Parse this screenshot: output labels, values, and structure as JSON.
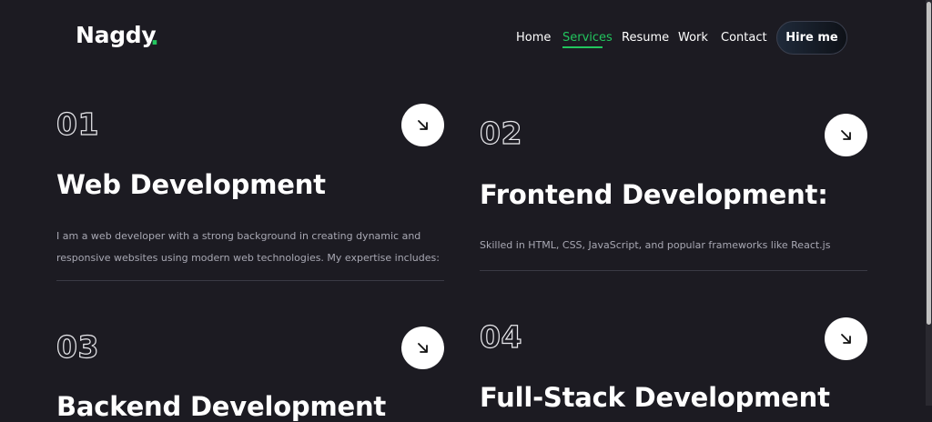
{
  "header": {
    "logo": "Nagdy",
    "logo_dot": ".",
    "nav": [
      {
        "label": "Home"
      },
      {
        "label": "Services"
      },
      {
        "label": "Resume"
      },
      {
        "label": "Work"
      },
      {
        "label": "Contact"
      }
    ],
    "hire_label": "Hire me"
  },
  "services": [
    {
      "num": "01",
      "title": "Web Development",
      "description": "I am a web developer with a strong background in creating dynamic and responsive websites using modern web technologies. My expertise includes:"
    },
    {
      "num": "02",
      "title": "Frontend Development:",
      "description": "Skilled in HTML, CSS, JavaScript, and popular frameworks like React.js"
    },
    {
      "num": "03",
      "title": "Backend Development"
    },
    {
      "num": "04",
      "title": "Full-Stack Development"
    }
  ],
  "colors": {
    "background": "#1c1b22",
    "accent": "#22c55e",
    "text": "#ffffff",
    "muted_text": "#a8a8b3"
  },
  "icons": {
    "arrow": "arrow-down-right-icon"
  }
}
